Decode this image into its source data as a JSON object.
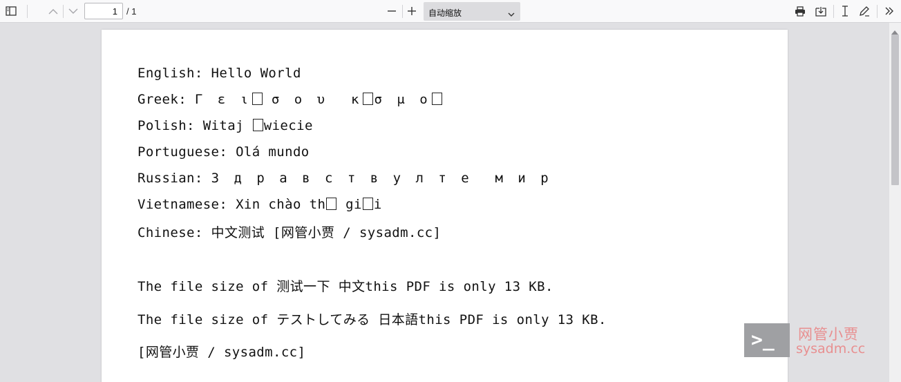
{
  "toolbar": {
    "page_number": "1",
    "page_total": "/ 1",
    "zoom_value": "自动缩放"
  },
  "icons": {
    "sidebar": "sidebar-toggle-icon",
    "prev": "chevron-up-icon",
    "next": "chevron-down-icon",
    "zoom_out": "minus-icon",
    "zoom_in": "plus-icon",
    "print": "printer-icon",
    "save": "download-icon",
    "text_select": "text-cursor-icon",
    "draw": "pen-icon",
    "more": "double-chevron-right-icon"
  },
  "document": {
    "lines": {
      "english": "English: Hello World",
      "greek_prefix": "Greek: ",
      "greek_1": "Γ ε ι",
      "greek_2": "σ ο υ  κ",
      "greek_3": "σ μ ο",
      "polish_prefix": "Polish: Witaj ",
      "polish_suffix": "wiecie",
      "portuguese": "Portuguese: Olá mundo",
      "russian_prefix": "Russian: ",
      "russian_words": "З д р а в с т в у л т е  м и р",
      "vietnamese_prefix": "Vietnamese: Xin chào th",
      "vietnamese_mid": " gi",
      "vietnamese_suffix": "i",
      "chinese": "Chinese: 中文测试 [网管小贾 / sysadm.cc]",
      "file_size_cn": "The file size of 测试一下 中文this PDF is only 13 KB.",
      "file_size_jp": "The file size of テストしてみる 日本語this PDF is only 13 KB.",
      "signature": "[网管小贾 / sysadm.cc]"
    }
  },
  "watermark": {
    "prompt_symbol": ">_",
    "cn_text": "网管小贾",
    "url_text": "sysadm.cc"
  },
  "colors": {
    "toolbar_bg": "#f9f9fa",
    "viewer_bg": "#e0e0e3",
    "watermark_red": "#ea7878"
  }
}
